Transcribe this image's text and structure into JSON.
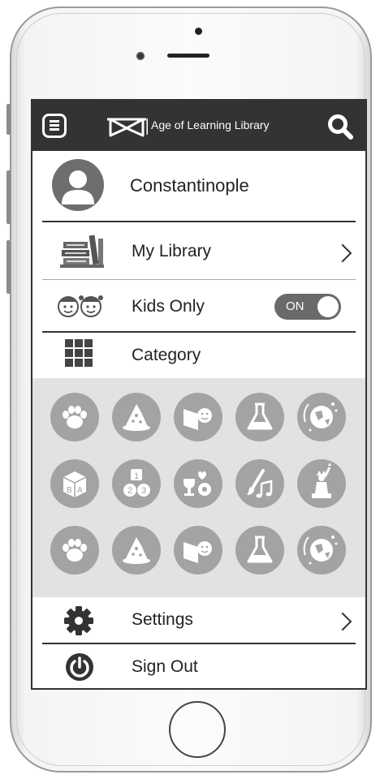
{
  "header": {
    "title": "Age of Learning Library"
  },
  "profile": {
    "name": "Constantinople"
  },
  "menu": {
    "my_library": "My Library",
    "kids_only": "Kids Only",
    "kids_only_toggle": "ON",
    "category": "Category",
    "settings": "Settings",
    "sign_out": "Sign Out"
  },
  "categories": [
    {
      "icon": "paw-icon"
    },
    {
      "icon": "wizard-hat-icon"
    },
    {
      "icon": "reading-book-icon"
    },
    {
      "icon": "science-flask-icon"
    },
    {
      "icon": "globe-icon"
    },
    {
      "icon": "alphabet-block-icon"
    },
    {
      "icon": "number-blocks-icon"
    },
    {
      "icon": "trophy-ball-icon"
    },
    {
      "icon": "art-music-icon"
    },
    {
      "icon": "statue-of-liberty-icon"
    },
    {
      "icon": "paw-icon"
    },
    {
      "icon": "wizard-hat-icon"
    },
    {
      "icon": "reading-book-icon"
    },
    {
      "icon": "science-flask-icon"
    },
    {
      "icon": "globe-icon"
    }
  ],
  "number_block_digits": [
    "1",
    "2",
    "3"
  ],
  "alphabet_block_letters": [
    "B",
    "A"
  ],
  "colors": {
    "header_bg": "#333333",
    "category_bg": "#e2e2e2",
    "category_circle": "#a3a3a3",
    "toggle_bg": "#6a6a6a"
  }
}
